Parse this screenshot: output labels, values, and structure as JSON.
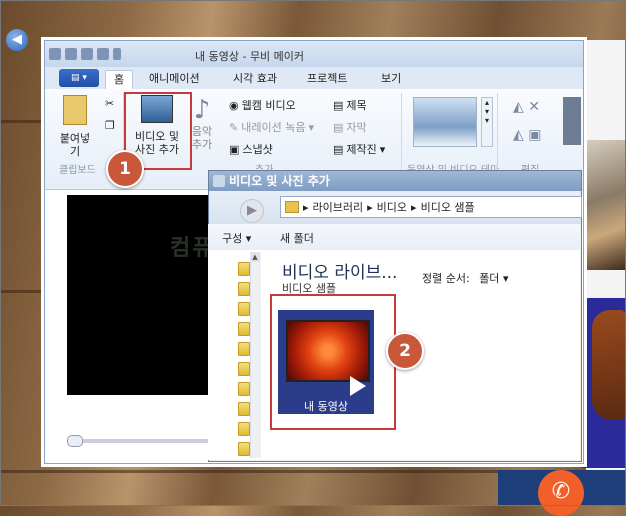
{
  "window": {
    "title": "내 동영상 - 무비 메이커"
  },
  "ribbon": {
    "tabs": [
      {
        "label": "홈",
        "active": true
      },
      {
        "label": "애니메이션"
      },
      {
        "label": "시각 효과"
      },
      {
        "label": "프로젝트"
      },
      {
        "label": "보기"
      }
    ],
    "paste_label": "붙여넣기",
    "clipboard_group": "클립보드",
    "add_video_photo_line1": "비디오 및",
    "add_video_photo_line2": "사진 추가",
    "music_line1": "음악",
    "music_line2": "추가",
    "webcam_video": "웹캠 비디오",
    "narration": "내레이션 녹음",
    "snapshot": "스냅샷",
    "title_btn": "제목",
    "caption_btn": "자막",
    "credits_btn": "제작진",
    "add_group": "추가",
    "theme_group": "동영상 및 비디오 테마",
    "edit_group": "편집"
  },
  "dialog": {
    "title": "비디오 및 사진 추가",
    "breadcrumb": [
      "라이브러리",
      "비디오",
      "비디오 샘플"
    ],
    "organize": "구성",
    "new_folder": "새 폴더",
    "library_title": "비디오 라이브...",
    "library_sub": "비디오 샘플",
    "sort_label": "정렬 순서:",
    "sort_value": "폴더",
    "file_label": "내 동영상"
  },
  "annotations": {
    "step1": "1",
    "step2": "2",
    "accent": "#c9573a"
  },
  "watermark": "컴퓨터가 닷컴"
}
